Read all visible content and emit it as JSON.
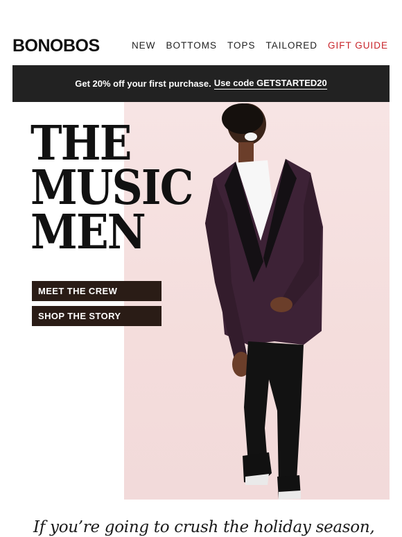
{
  "header": {
    "logo": "BONOBOS",
    "nav": [
      {
        "label": "NEW"
      },
      {
        "label": "BOTTOMS"
      },
      {
        "label": "TOPS"
      },
      {
        "label": "TAILORED"
      },
      {
        "label": "GIFT GUIDE"
      }
    ],
    "accent_color": "#c8242a"
  },
  "promo": {
    "text": "Get 20% off your first purchase.",
    "code_text": "Use code GETSTARTED20"
  },
  "hero": {
    "headline": [
      "THE",
      "MUSIC",
      "MEN"
    ],
    "buttons": [
      {
        "label": "MEET THE CREW"
      },
      {
        "label": "SHOP THE STORY"
      }
    ],
    "background_color": "#f4dddc",
    "image_subject": "man laughing in purple tuxedo jacket and black sneakers"
  },
  "body": {
    "intro": "If you’re going to crush the holiday season,"
  }
}
